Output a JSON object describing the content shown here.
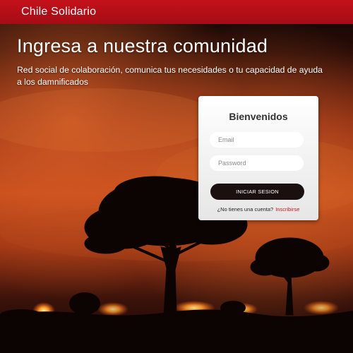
{
  "navbar": {
    "brand": "Chile Solidario"
  },
  "hero": {
    "headline": "Ingresa a nuestra comunidad",
    "subtitle": "Red social de colaboración, comunica tus necesidades o tu capacidad de ayuda a los damnificados"
  },
  "login": {
    "title": "Bienvenidos",
    "email_placeholder": "Email",
    "password_placeholder": "Password",
    "submit_label": "INICIAR SESION",
    "signup_prompt": "¿No tienes una cuenta?",
    "signup_link": "Inscribirse"
  },
  "colors": {
    "brand_red": "#c4111b",
    "button_dark": "#1a1010",
    "link_red": "#d0101a"
  }
}
